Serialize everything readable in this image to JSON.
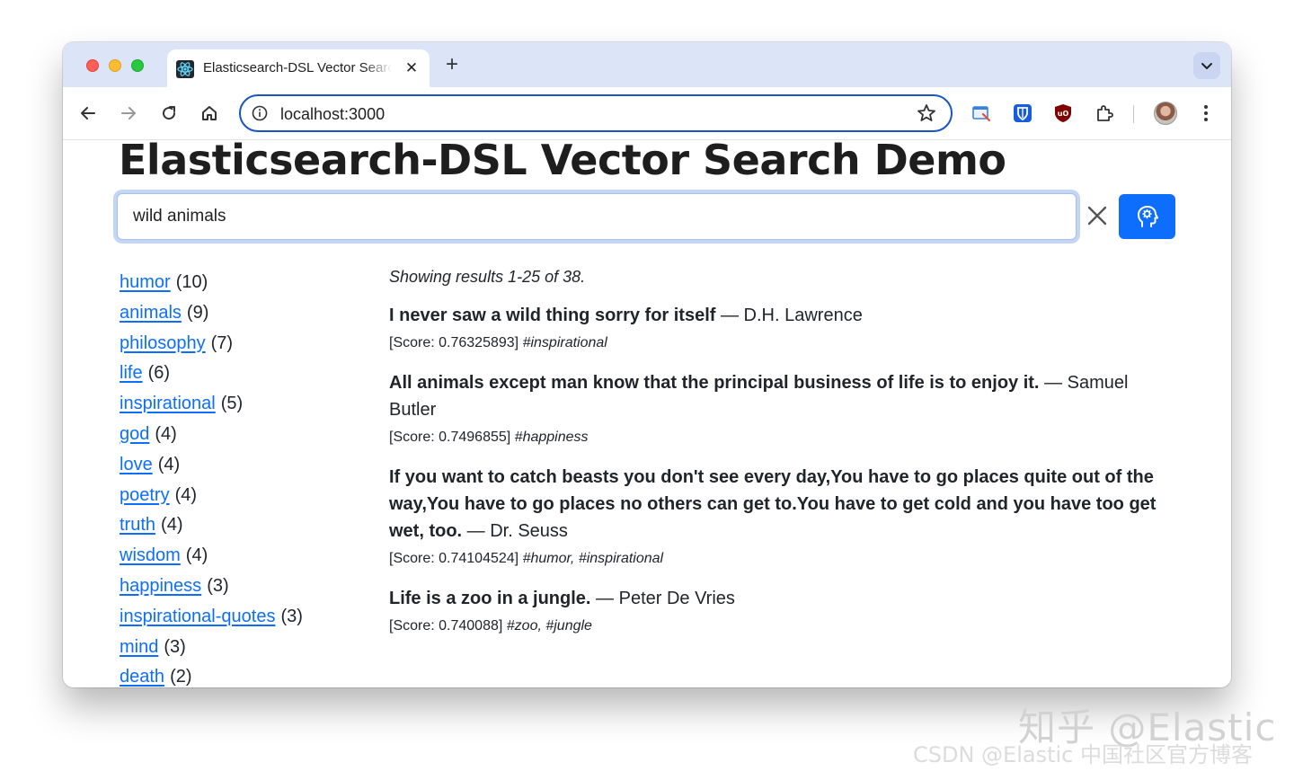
{
  "browser": {
    "tab_title": "Elasticsearch-DSL Vector Search Demo",
    "tab_close": "✕",
    "new_tab": "+",
    "url": "localhost:3000"
  },
  "page": {
    "title": "Elasticsearch-DSL Vector Search Demo",
    "search_value": "wild animals",
    "summary": "Showing results 1-25 of 38."
  },
  "tags": [
    {
      "name": "humor",
      "count": "(10)"
    },
    {
      "name": "animals",
      "count": "(9)"
    },
    {
      "name": "philosophy",
      "count": "(7)"
    },
    {
      "name": "life",
      "count": "(6)"
    },
    {
      "name": "inspirational",
      "count": "(5)"
    },
    {
      "name": "god",
      "count": "(4)"
    },
    {
      "name": "love",
      "count": "(4)"
    },
    {
      "name": "poetry",
      "count": "(4)"
    },
    {
      "name": "truth",
      "count": "(4)"
    },
    {
      "name": "wisdom",
      "count": "(4)"
    },
    {
      "name": "happiness",
      "count": "(3)"
    },
    {
      "name": "inspirational-quotes",
      "count": "(3)"
    },
    {
      "name": "mind",
      "count": "(3)"
    },
    {
      "name": "death",
      "count": "(2)"
    }
  ],
  "results": [
    {
      "quote": "I never saw a wild thing sorry for itself",
      "author": "— D.H. Lawrence",
      "score": "[Score: 0.76325893]",
      "tags": "#inspirational"
    },
    {
      "quote": "All animals except man know that the principal business of life is to enjoy it.",
      "author": "— Samuel Butler",
      "score": "[Score: 0.7496855]",
      "tags": "#happiness"
    },
    {
      "quote": "If you want to catch beasts you don't see every day,You have to go places quite out of the way,You have to go places no others can get to.You have to get cold and you have too get wet, too.",
      "author": "— Dr. Seuss",
      "score": "[Score: 0.74104524]",
      "tags": "#humor, #inspirational"
    },
    {
      "quote": "Life is a zoo in a jungle.",
      "author": "— Peter De Vries",
      "score": "[Score: 0.740088]",
      "tags": "#zoo, #jungle"
    }
  ],
  "watermark": {
    "line1": "知乎 @Elastic",
    "line2": "CSDN @Elastic 中国社区官方博客"
  },
  "colors": {
    "accent": "#0d6efd",
    "link": "#0d6efd",
    "titlebar": "#dce4f8",
    "omnibox_border": "#1a56c2"
  }
}
